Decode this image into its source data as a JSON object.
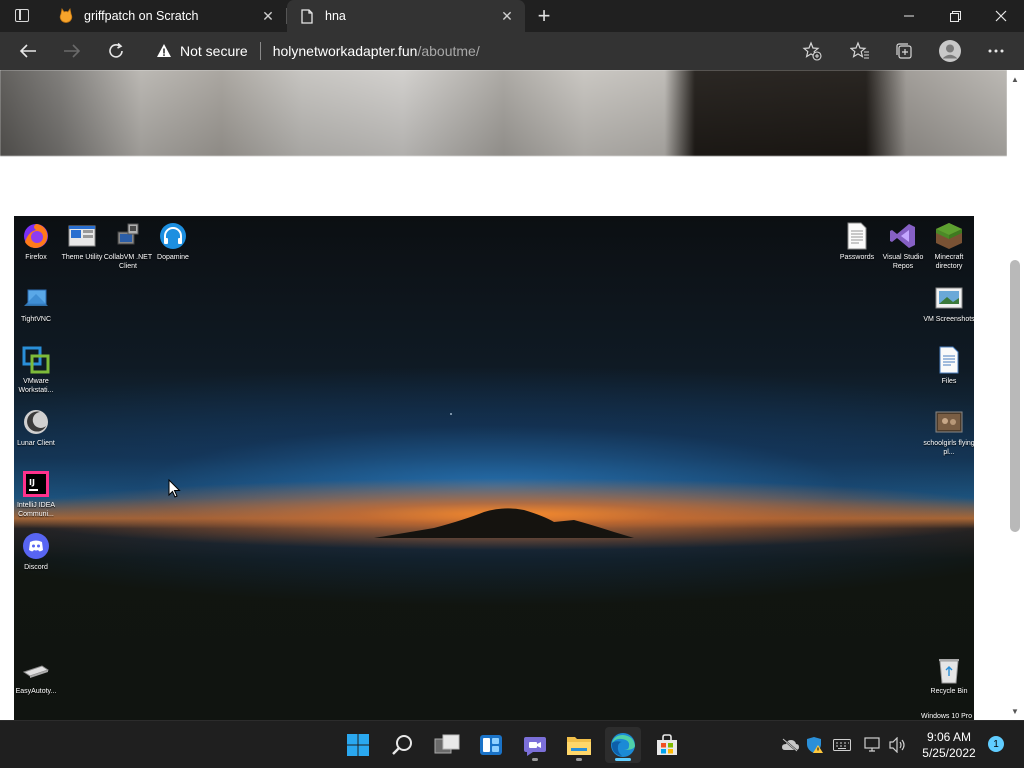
{
  "browser": {
    "tabs": [
      {
        "title": "griffpatch on Scratch",
        "favicon": "scratch-cat-icon"
      },
      {
        "title": "hna",
        "favicon": "page-icon"
      }
    ],
    "security_label": "Not secure",
    "url_host": "holynetworkadapter.fun",
    "url_path": "/aboutme/"
  },
  "desktop": {
    "left_icons": [
      {
        "label": "Firefox",
        "icon": "firefox-icon"
      },
      {
        "label": "Theme Utility",
        "icon": "theme-utility-icon"
      },
      {
        "label": "CollabVM .NET Client",
        "icon": "collabvm-icon"
      },
      {
        "label": "Dopamine",
        "icon": "dopamine-icon"
      },
      {
        "label": "TightVNC",
        "icon": "tightvnc-icon"
      },
      {
        "label": "VMware Workstati...",
        "icon": "vmware-icon"
      },
      {
        "label": "Lunar Client",
        "icon": "lunar-client-icon"
      },
      {
        "label": "IntelliJ IDEA Communi...",
        "icon": "intellij-icon"
      },
      {
        "label": "Discord",
        "icon": "discord-icon"
      },
      {
        "label": "EasyAutoty...",
        "icon": "keyboard-icon"
      }
    ],
    "right_icons": [
      {
        "label": "Passwords",
        "icon": "text-file-icon"
      },
      {
        "label": "Visual Studio Repos",
        "icon": "visual-studio-icon"
      },
      {
        "label": "Minecraft directory",
        "icon": "minecraft-icon"
      },
      {
        "label": "VM Screenshots",
        "icon": "image-file-icon"
      },
      {
        "label": "Files",
        "icon": "files-icon"
      },
      {
        "label": "schoolgirls flying pl...",
        "icon": "photo-file-icon"
      },
      {
        "label": "Recycle Bin",
        "icon": "recycle-bin-icon"
      }
    ],
    "watermark": "Windows 10 Pro"
  },
  "taskbar": {
    "apps": [
      "start-icon",
      "search-icon",
      "task-view-icon",
      "widgets-icon",
      "teams-chat-icon",
      "file-explorer-icon",
      "edge-icon",
      "store-icon"
    ],
    "time": "9:06 AM",
    "date": "5/25/2022",
    "notification_count": "1"
  },
  "colors": {
    "accent": "#60cdff",
    "chrome_bg": "#202020",
    "toolbar_bg": "#333333"
  }
}
